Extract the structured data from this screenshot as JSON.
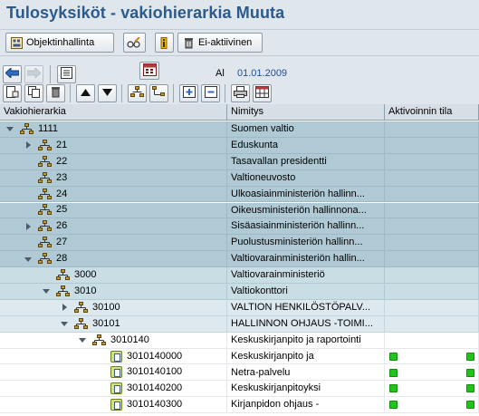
{
  "title": "Tulosyksiköt - vakiohierarkia Muuta",
  "toolbar": {
    "objektinhallinta": "Objektinhallinta",
    "ei_aktiivinen": "Ei-aktiivinen"
  },
  "date": {
    "label": "Al",
    "value": "01.01.2009"
  },
  "columns": [
    "Vakiohierarkia",
    "Nimitys",
    "Aktivoinnin tila"
  ],
  "rows": [
    {
      "code": "1111",
      "name": "Suomen valtio",
      "level": 0,
      "toggle": "col",
      "type": "hier",
      "style": "sel1",
      "status": false
    },
    {
      "code": "21",
      "name": "Eduskunta",
      "level": 1,
      "toggle": "exp",
      "type": "hier",
      "style": "sel1",
      "status": false
    },
    {
      "code": "22",
      "name": "Tasavallan presidentti",
      "level": 1,
      "toggle": "none",
      "type": "hier",
      "style": "sel1",
      "status": false
    },
    {
      "code": "23",
      "name": "Valtioneuvosto",
      "level": 1,
      "toggle": "none",
      "type": "hier",
      "style": "sel1",
      "status": false
    },
    {
      "code": "24",
      "name": "Ulkoasiainministeriön hallinn...",
      "level": 1,
      "toggle": "none",
      "type": "hier",
      "style": "sel1",
      "status": false
    },
    {
      "code": "25",
      "name": "Oikeusministeriön hallinnona...",
      "level": 1,
      "toggle": "none",
      "type": "hier",
      "style": "sel1",
      "status": false
    },
    {
      "code": "26",
      "name": "Sisäasiainministeriön hallinn...",
      "level": 1,
      "toggle": "exp",
      "type": "hier",
      "style": "sel1",
      "status": false
    },
    {
      "code": "27",
      "name": "Puolustusministeriön hallinn...",
      "level": 1,
      "toggle": "none",
      "type": "hier",
      "style": "sel1",
      "status": false
    },
    {
      "code": "28",
      "name": "Valtiovarainministeriön hallin...",
      "level": 1,
      "toggle": "col",
      "type": "hier",
      "style": "sel1",
      "status": false
    },
    {
      "code": "3000",
      "name": "Valtiovarainministeriö",
      "level": 2,
      "toggle": "none",
      "type": "hier",
      "style": "sel2",
      "status": false
    },
    {
      "code": "3010",
      "name": "Valtiokonttori",
      "level": 2,
      "toggle": "col",
      "type": "hier",
      "style": "sel2",
      "status": false
    },
    {
      "code": "30100",
      "name": "VALTION HENKILÖSTÖPALV...",
      "level": 3,
      "toggle": "exp",
      "type": "hier",
      "style": "sel3",
      "status": false
    },
    {
      "code": "30101",
      "name": "HALLINNON OHJAUS -TOIMI...",
      "level": 3,
      "toggle": "col",
      "type": "hier",
      "style": "sel3",
      "status": false
    },
    {
      "code": "3010140",
      "name": "Keskuskirjanpito ja raportointi",
      "level": 4,
      "toggle": "col",
      "type": "hier",
      "style": "plain",
      "status": false
    },
    {
      "code": "3010140000",
      "name": "Keskuskirjanpito ja",
      "level": 5,
      "toggle": "none",
      "type": "leaf",
      "style": "plain",
      "status": true
    },
    {
      "code": "3010140100",
      "name": "Netra-palvelu",
      "level": 5,
      "toggle": "none",
      "type": "leaf",
      "style": "plain",
      "status": true
    },
    {
      "code": "3010140200",
      "name": "Keskuskirjanpitoyksi",
      "level": 5,
      "toggle": "none",
      "type": "leaf",
      "style": "plain",
      "status": true
    },
    {
      "code": "3010140300",
      "name": "Kirjanpidon ohjaus -",
      "level": 5,
      "toggle": "none",
      "type": "leaf",
      "style": "plain",
      "status": true
    }
  ]
}
